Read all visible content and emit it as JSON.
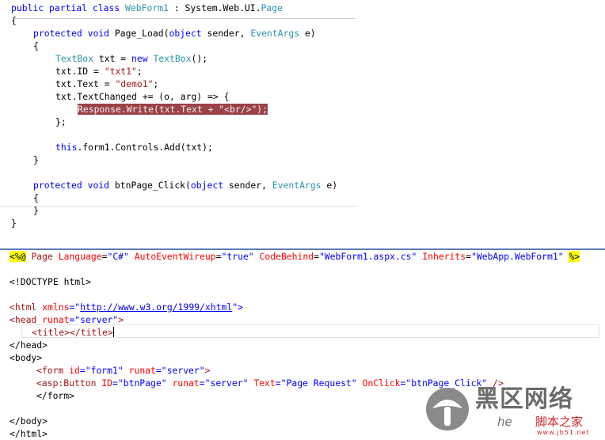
{
  "cs_code": {
    "l1": {
      "a": "public",
      "b": "partial",
      "c": "class",
      "d": "WebForm1",
      "e": " : System.Web.UI.",
      "f": "Page"
    },
    "l2": "{",
    "l3": {
      "a": "protected",
      "b": "void",
      "c": " Page_Load(",
      "d": "object",
      "e": " sender, ",
      "f": "EventArgs",
      "g": " e)"
    },
    "l4": "{",
    "l5": {
      "a": "TextBox",
      "b": " txt = ",
      "c": "new",
      "d": "TextBox",
      "e": "();"
    },
    "l6": {
      "a": "txt.ID = ",
      "b": "\"txt1\"",
      "c": ";"
    },
    "l7": {
      "a": "txt.Text = ",
      "b": "\"demo1\"",
      "c": ";"
    },
    "l8": "txt.TextChanged += (o, arg) => {",
    "l9": "Response.Write(txt.Text + \"<br/>\");",
    "l10": "};",
    "l11": {
      "a": "this",
      "b": ".form1.Controls.Add(txt);"
    },
    "l12": "}",
    "l13": {
      "a": "protected",
      "b": "void",
      "c": " btnPage_Click(",
      "d": "object",
      "e": " sender, ",
      "f": "EventArgs",
      "g": " e)"
    },
    "l14": "{",
    "l15": "}",
    "l16": "}"
  },
  "aspx_code": {
    "l1": {
      "open": "<%@",
      "page": "Page",
      "a1": "Language",
      "v1": "\"C#\"",
      "a2": "AutoEventWireup",
      "v2": "\"true\"",
      "a3": "CodeBehind",
      "v3": "\"WebForm1.aspx.cs\"",
      "a4": "Inherits",
      "v4": "\"WebApp.WebForm1\"",
      "close": "%>"
    },
    "l2": "<!DOCTYPE html>",
    "l3": {
      "a": "<html",
      "b": "xmlns",
      "c": "=\"",
      "d": "http://www.w3.org/1999/xhtml",
      "e": "\">"
    },
    "l4": {
      "a": "<head",
      "b": "runat",
      "c": "=\"server\"",
      "d": ">"
    },
    "l5": {
      "a": "<title></title>"
    },
    "l6": "</head>",
    "l7": "<body>",
    "l8": {
      "a": "<form",
      "b": "id",
      "c": "=\"form1\"",
      "d": "runat",
      "e": "=\"server\"",
      "f": ">"
    },
    "l9": {
      "a": "<asp:Button",
      "b": "ID",
      "c": "=\"btnPage\"",
      "d": "runat",
      "e": "=\"server\"",
      "f": "Text",
      "g": "=\"Page Request\"",
      "h": "OnClick",
      "i": "=\"btnPage_Click\"",
      "j": "/>"
    },
    "l10": "</form>",
    "l11": "</body>",
    "l12": "</html>"
  },
  "watermark": {
    "title": "黑区网络",
    "domain": "he",
    "chinese": "脚本之家",
    "site": "www.jb51.net"
  }
}
